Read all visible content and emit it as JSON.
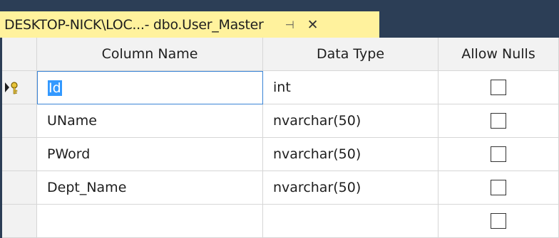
{
  "tab": {
    "title": "DESKTOP-NICK\\LOC...- dbo.User_Master",
    "pin_icon": "pin-icon",
    "close_icon": "close-icon"
  },
  "grid": {
    "headers": {
      "column_name": "Column Name",
      "data_type": "Data Type",
      "allow_nulls": "Allow Nulls"
    },
    "rows": [
      {
        "name": "Id",
        "type": "int",
        "allow_nulls": false,
        "primary_key": true
      },
      {
        "name": "UName",
        "type": "nvarchar(50)",
        "allow_nulls": false
      },
      {
        "name": "PWord",
        "type": "nvarchar(50)",
        "allow_nulls": false
      },
      {
        "name": "Dept_Name",
        "type": "nvarchar(50)",
        "allow_nulls": false
      },
      {
        "name": "",
        "type": "",
        "allow_nulls": false
      }
    ]
  },
  "colors": {
    "tab_active": "#fff29d",
    "background": "#2c3e56",
    "selection": "#3399ff",
    "edit_border": "#3a84d6"
  }
}
